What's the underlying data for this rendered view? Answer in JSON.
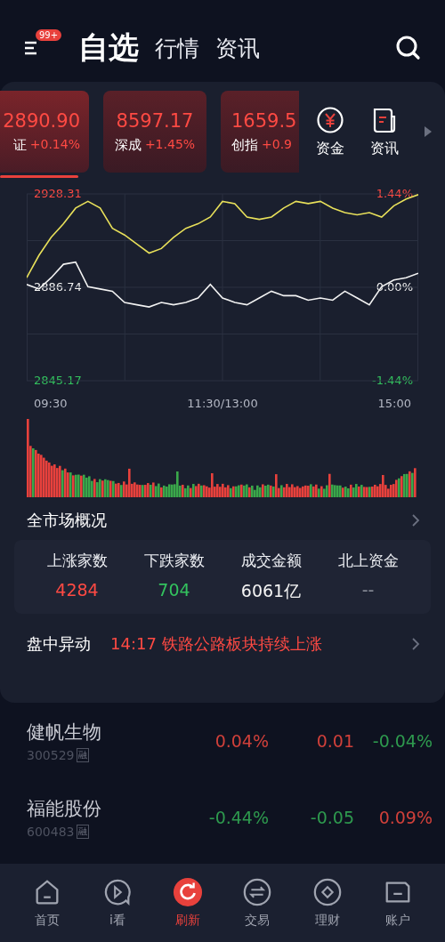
{
  "header": {
    "badge": "99+",
    "tabs": [
      {
        "label": "自选",
        "selected": true
      },
      {
        "label": "行情",
        "selected": false
      },
      {
        "label": "资讯",
        "selected": false
      }
    ]
  },
  "indices": [
    {
      "value": "2890.90",
      "name": "证",
      "change": "+0.14%",
      "selected": true
    },
    {
      "value": "8597.17",
      "name": "深成",
      "change": "+1.45%",
      "selected": false
    },
    {
      "value": "1659.5",
      "name": "创指",
      "change": "+0.9",
      "selected": false
    }
  ],
  "shortcuts": [
    {
      "kind": "funds",
      "label": "资金"
    },
    {
      "kind": "news",
      "label": "资讯"
    }
  ],
  "chart": {
    "right_labels": [
      {
        "text": "1.44%",
        "color": "#ff4a43"
      },
      {
        "text": "0.00%",
        "color": "#f4f4f4"
      },
      {
        "text": "-1.44%",
        "color": "#33c25e"
      }
    ],
    "time_labels": [
      "09:30",
      "11:30/13:00",
      "15:00"
    ],
    "chart_data": {
      "type": "line",
      "grid": true,
      "ylim": [
        2845.17,
        2928.31
      ],
      "yticks": [
        {
          "value": 2928.31,
          "label": "2928.31"
        },
        {
          "value": 2886.74,
          "label": "2886.74"
        },
        {
          "value": 2845.17,
          "label": "2845.17"
        }
      ],
      "series": [
        {
          "color": "#f2f2f2",
          "values": [
            2888,
            2886,
            2891,
            2897,
            2898,
            2887,
            2886,
            2885,
            2880,
            2879,
            2878,
            2880,
            2879,
            2880,
            2882,
            2888,
            2882,
            2880,
            2879,
            2882,
            2885,
            2883,
            2883,
            2881,
            2882,
            2881,
            2885,
            2882,
            2879,
            2887,
            2890,
            2891,
            2893
          ]
        },
        {
          "color": "#e8e05a",
          "values": [
            2891,
            2901,
            2909,
            2915,
            2922,
            2925,
            2922,
            2913,
            2910,
            2906,
            2902,
            2904,
            2909,
            2913,
            2915,
            2918,
            2925,
            2924,
            2918,
            2917,
            2918,
            2922,
            2925,
            2924,
            2925,
            2922,
            2920,
            2919,
            2920,
            2918,
            2923,
            2926,
            2928
          ]
        }
      ]
    }
  },
  "overview": {
    "title": "全市场概况",
    "stats": [
      {
        "label": "上涨家数",
        "value": "4284",
        "color": "#ff4a43"
      },
      {
        "label": "下跌家数",
        "value": "704",
        "color": "#33c25e"
      },
      {
        "label": "成交金额",
        "value": "6061亿",
        "color": "#f4f4f4"
      },
      {
        "label": "北上资金",
        "value": "--",
        "color": "#8a8e9a"
      }
    ]
  },
  "alert": {
    "title": "盘中异动",
    "time": "14:17",
    "text": "铁路公路板块持续上涨"
  },
  "watchlist": [
    {
      "name": "健帆生物",
      "code": "300529",
      "tag": "融",
      "values": [
        {
          "text": "0.04%",
          "color": "#d0403a"
        },
        {
          "text": "0.01",
          "color": "#d0403a"
        },
        {
          "text": "-0.04%",
          "color": "#2e9a4e"
        }
      ]
    },
    {
      "name": "福能股份",
      "code": "600483",
      "tag": "融",
      "values": [
        {
          "text": "-0.44%",
          "color": "#2e9a4e"
        },
        {
          "text": "-0.05",
          "color": "#2e9a4e"
        },
        {
          "text": "0.09%",
          "color": "#d0403a"
        }
      ]
    }
  ],
  "nav": [
    {
      "kind": "home",
      "label": "首页",
      "selected": false
    },
    {
      "kind": "watch",
      "label": "i看",
      "selected": false
    },
    {
      "kind": "refresh",
      "label": "刷新",
      "selected": true
    },
    {
      "kind": "trade",
      "label": "交易",
      "selected": false
    },
    {
      "kind": "wealth",
      "label": "理财",
      "selected": false
    },
    {
      "kind": "account",
      "label": "账户",
      "selected": false
    }
  ]
}
